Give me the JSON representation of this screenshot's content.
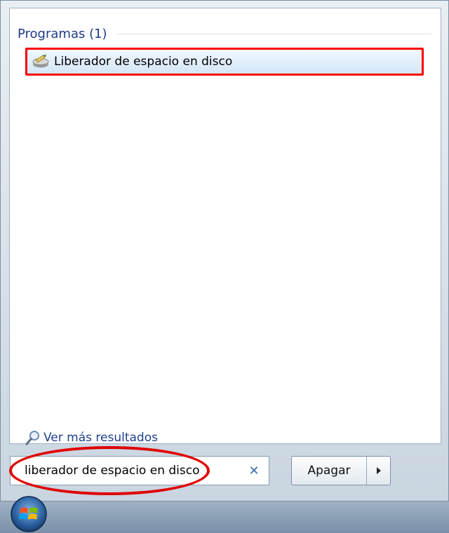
{
  "results": {
    "group_title": "Programas (1)",
    "items": [
      {
        "label": "Liberador de espacio en disco",
        "icon": "disk-cleanup-icon"
      }
    ],
    "see_more": "Ver más resultados"
  },
  "search": {
    "value": "liberador de espacio en disco",
    "clear_glyph": "✕"
  },
  "power": {
    "label": "Apagar"
  },
  "colors": {
    "highlight": "#ff0000",
    "link": "#1f3f8f",
    "group_title": "#1e3a8a"
  }
}
